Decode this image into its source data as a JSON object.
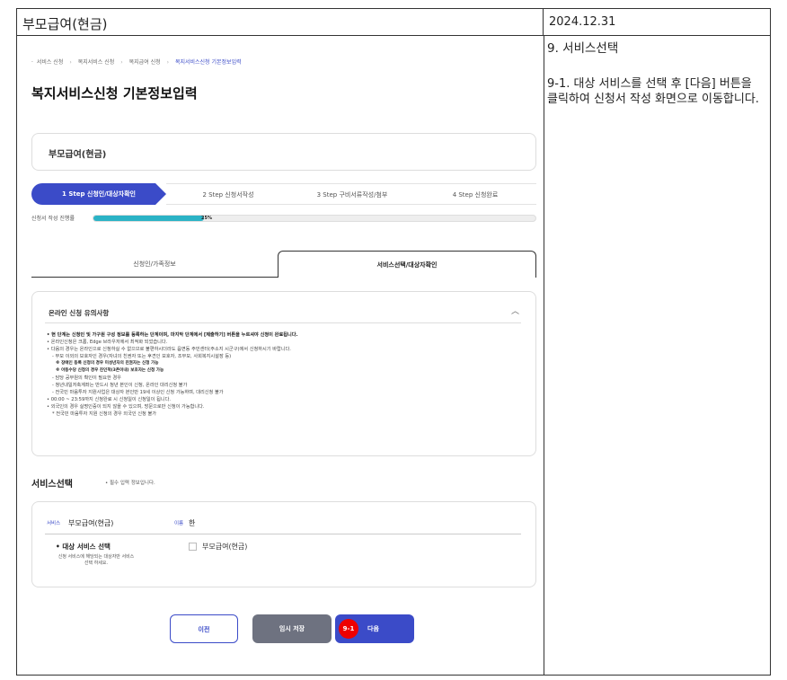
{
  "header": {
    "title": "부모급여(현금)",
    "date": "2024.12.31"
  },
  "description": {
    "step_title": "9. 서비스선택",
    "text": "9-1. 대상 서비스를 선택 후 [다음] 버튼을 클릭하여 신청서 작성 화면으로 이동합니다."
  },
  "breadcrumb": [
    "서비스 신청",
    "복지서비스 신청",
    "복지급여 신청",
    "복지서비스신청 기본정보입력"
  ],
  "page_title": "복지서비스신청 기본정보입력",
  "service_name": "부모급여(현금)",
  "steps": [
    "1 Step 신청인/대상자확인",
    "2 Step 신청서작성",
    "3 Step 구비서류작성/첨부",
    "4 Step 신청완료"
  ],
  "progress": {
    "label": "신청서 작성 진행률",
    "percent": 25,
    "text": "25%"
  },
  "tabs": [
    "신청인/가족정보",
    "서비스선택/대상자확인"
  ],
  "notice": {
    "title": "온라인 신청 유의사항",
    "lines": [
      "• 현 단계는 신청인 및 가구원 구성 정보를 등록하는 단계이며, 마지막 단계에서 [제출하기] 버튼을 누르셔야 신청이 완료됩니다.",
      "• 온라인신청은 크롬, Edge 브라우저에서 최적화 되었습니다.",
      "• 다음의 경우는 온라인으로 신청하실 수 없으므로 불편하시더라도 읍면동 주민센터(주소지 시군구)에서 신청하시기 바랍니다.",
      "- 부모 이외의 보호자인 경우(자녀의 친권자 또는 후견인 보호자, 조부모, 사회복지시설장 등)",
      "※ 장애인 등록 신청의 경우 미성년자의 친권자는 신청 가능",
      "※ 아동수당 신청의 경우 친인척(3촌이내) 보호자는 신청 가능",
      "- 담당 공무원의 확인이 필요한 경우",
      "- 청년내일저축계좌는 반드시 청년 본인이 신청, 온라인 대리신청 불가",
      "- 전국민 마음투자 지원사업은 대상자 본인만 19세 이상인 신청 가능하며, 대리신청 불가",
      "• 00:00 ~ 23:59까지 신청완료 시 신청일이 신청일이 됩니다.",
      "• 외국인의 경우 실명인증이 되지 않을 수 있으며, 방문으로만 신청이 가능합니다.",
      "* 전국민 마음투자 지원 신청의 경우 외국인 신청 불가"
    ]
  },
  "service_section": {
    "title": "서비스선택",
    "note": "• 필수 입력 정보입니다.",
    "service_label": "서비스",
    "service_value": "부모급여(현금)",
    "name_label": "이름",
    "name_value": "한",
    "target_label": "• 대상 서비스 선택",
    "target_help": "신청 서비스에 해당되는 대상자만 서비스 선택 하세요.",
    "option_label": "부모급여(현금)"
  },
  "buttons": {
    "prev": "이전",
    "save": "임시 저장",
    "next": "다음",
    "badge": "9-1"
  },
  "colors": {
    "primary": "#3b4bc8",
    "progress": "#2bb3c6",
    "badge": "#ee0000",
    "save": "#6e7280"
  }
}
